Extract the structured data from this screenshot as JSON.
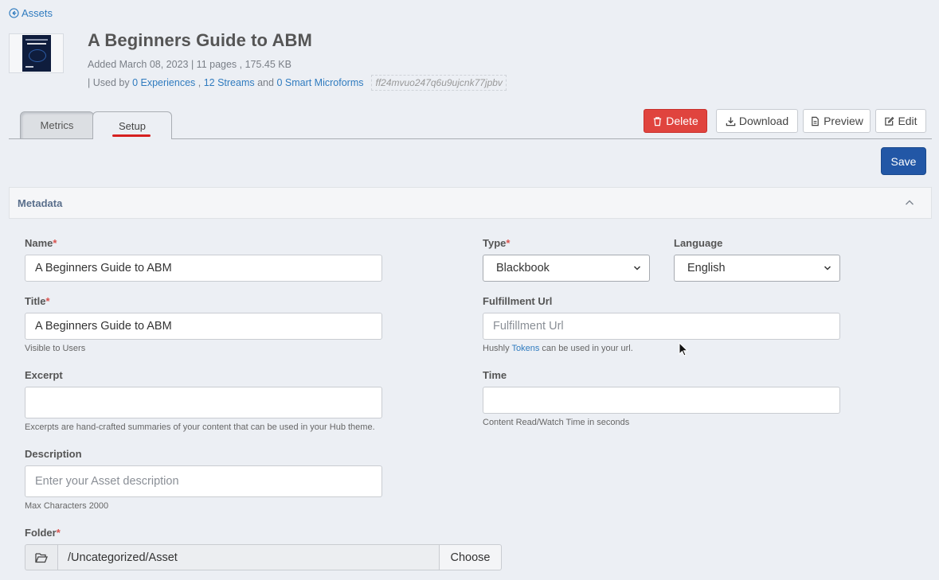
{
  "nav": {
    "back_label": "Assets"
  },
  "asset": {
    "title": "A Beginners Guide to ABM",
    "added_line": "Added March 08, 2023 | 11 pages , 175.45 KB",
    "used_by_prefix": "| Used by ",
    "experiences_link": "0 Experiences",
    "comma_sep": " , ",
    "streams_link": "12 Streams",
    "and_sep": " and ",
    "microforms_link": "0 Smart Microforms",
    "id": "ff24mvuo247q6u9ujcnk77jpbv"
  },
  "tabs": [
    {
      "label": "Metrics",
      "active": false
    },
    {
      "label": "Setup",
      "active": true
    }
  ],
  "actions": {
    "delete_label": "Delete",
    "download_label": "Download",
    "preview_label": "Preview",
    "edit_label": "Edit",
    "save_label": "Save"
  },
  "metadata": {
    "section_label": "Metadata",
    "required_mark": "*",
    "name": {
      "label": "Name",
      "value": "A Beginners Guide to ABM"
    },
    "title": {
      "label": "Title",
      "value": "A Beginners Guide to ABM",
      "help": "Visible to Users"
    },
    "excerpt": {
      "label": "Excerpt",
      "value": "",
      "help": "Excerpts are hand-crafted summaries of your content that can be used in your Hub theme."
    },
    "description": {
      "label": "Description",
      "placeholder": "Enter your Asset description",
      "help": "Max Characters 2000"
    },
    "folder": {
      "label": "Folder",
      "value": "/Uncategorized/Asset",
      "choose_label": "Choose"
    },
    "type": {
      "label": "Type",
      "value": "Blackbook"
    },
    "language": {
      "label": "Language",
      "value": "English"
    },
    "fulfillment_url": {
      "label": "Fulfillment Url",
      "placeholder": "Fulfillment Url",
      "help_prefix": "Hushly ",
      "help_link": "Tokens",
      "help_suffix": " can be used in your url."
    },
    "time": {
      "label": "Time",
      "value": "",
      "help": "Content Read/Watch Time in seconds"
    }
  },
  "colors": {
    "link": "#2f7bbf",
    "delete": "#e0443e",
    "save": "#2257a6",
    "required": "#d9534f",
    "active_tab_underline": "#d62020"
  },
  "icons": [
    "back-arrow-circle-icon",
    "trash-icon",
    "download-icon",
    "file-icon",
    "edit-icon",
    "chevron-up-icon",
    "chevron-down-icon",
    "folder-open-icon",
    "mouse-cursor-icon"
  ]
}
